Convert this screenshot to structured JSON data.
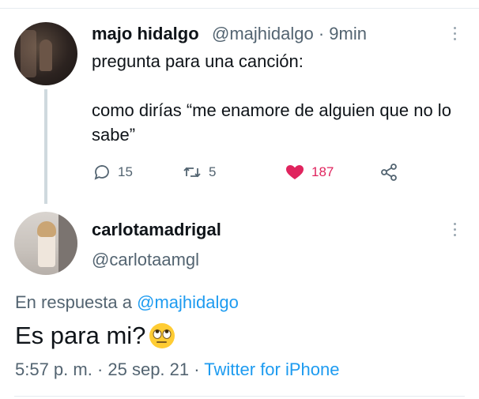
{
  "parent_tweet": {
    "display_name": "majo hidalgo",
    "meta": "@majhidalgo · 9min",
    "text": "pregunta para una canción:\n\ncomo dirías “me enamore de alguien que no lo sabe”",
    "actions": {
      "reply_count": "15",
      "retweet_count": "5",
      "like_count": "187"
    }
  },
  "reply_tweet": {
    "display_name": "carlotamadrigal",
    "handle": "@carlotaamgl",
    "in_reply_prefix": "En respuesta a ",
    "in_reply_handle": "@majhidalgo",
    "text": "Es para mi?",
    "timestamp": "5:57 p. m. · 25 sep. 21 · ",
    "source": "Twitter for iPhone"
  },
  "icons": {
    "reply": "comment-bubble-icon",
    "retweet": "retweet-arrows-icon",
    "like": "heart-icon",
    "share": "share-nodes-icon",
    "more": "more-vertical-icon",
    "emoji": "rolling-eyes-emoji-icon"
  },
  "colors": {
    "accent": "#1d9bf0",
    "like": "#e0245e",
    "secondary_text": "#536471"
  }
}
